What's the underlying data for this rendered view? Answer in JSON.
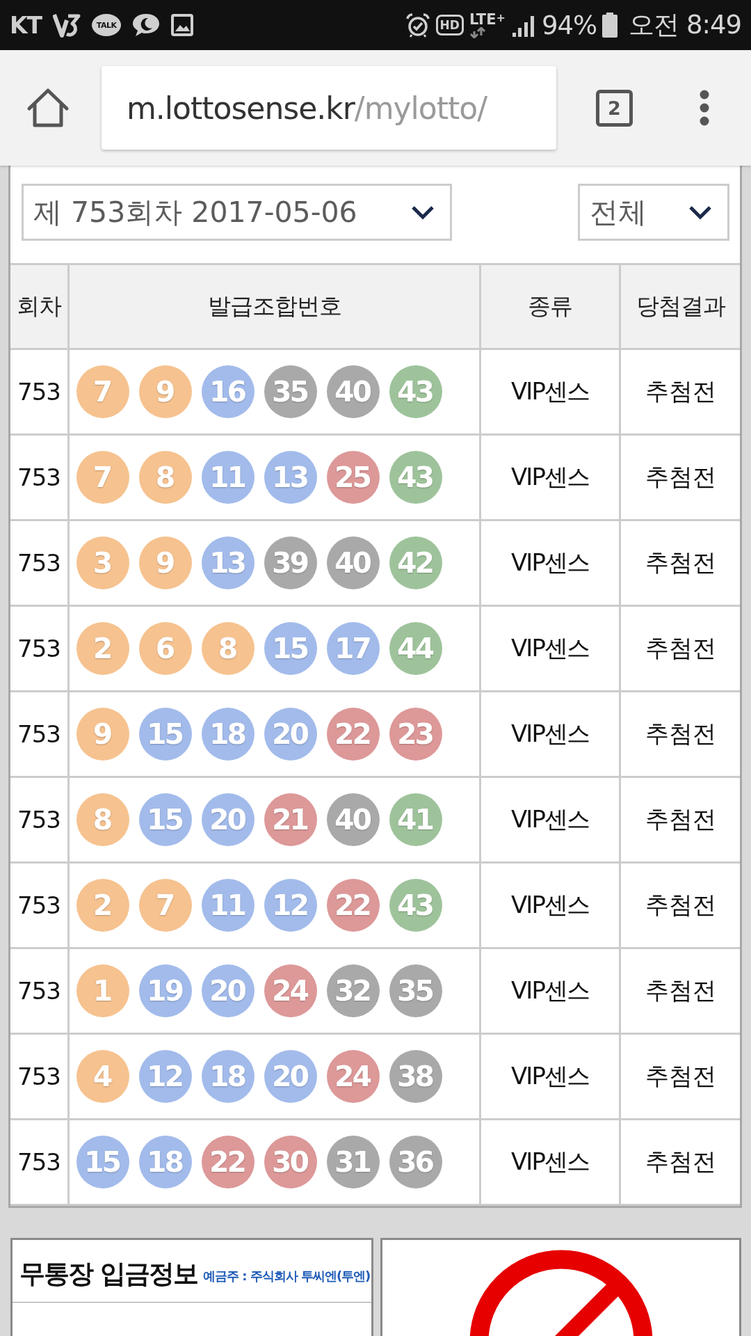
{
  "status_bar": {
    "carrier": "KT",
    "talk_label": "TALK",
    "hd_label": "HD",
    "network": "LTE$^{+}$",
    "battery": "94%",
    "time": "오전 8:49"
  },
  "browser": {
    "url_host": "m.lottosense.kr",
    "url_path": "/mylotto/",
    "tab_count": "2"
  },
  "round_select": {
    "value": "제 753회차 2017-05-06"
  },
  "type_select": {
    "value": "전체"
  },
  "table": {
    "columns": [
      "회차",
      "발급조합번호",
      "종류",
      "당첨결과"
    ],
    "rows": [
      {
        "round": "753",
        "balls": [
          {
            "number": "7",
            "color": "#f6c28f"
          },
          {
            "number": "9",
            "color": "#f6c28f"
          },
          {
            "number": "16",
            "color": "#a2bbeb"
          },
          {
            "number": "35",
            "color": "#a9a9a9"
          },
          {
            "number": "40",
            "color": "#a9a9a9"
          },
          {
            "number": "43",
            "color": "#9ec39b"
          }
        ],
        "type": "VIP센스",
        "result": "추첨전"
      },
      {
        "round": "753",
        "balls": [
          {
            "number": "7",
            "color": "#f6c28f"
          },
          {
            "number": "8",
            "color": "#f6c28f"
          },
          {
            "number": "11",
            "color": "#a2bbeb"
          },
          {
            "number": "13",
            "color": "#a2bbeb"
          },
          {
            "number": "25",
            "color": "#dd9898"
          },
          {
            "number": "43",
            "color": "#9ec39b"
          }
        ],
        "type": "VIP센스",
        "result": "추첨전"
      },
      {
        "round": "753",
        "balls": [
          {
            "number": "3",
            "color": "#f6c28f"
          },
          {
            "number": "9",
            "color": "#f6c28f"
          },
          {
            "number": "13",
            "color": "#a2bbeb"
          },
          {
            "number": "39",
            "color": "#a9a9a9"
          },
          {
            "number": "40",
            "color": "#a9a9a9"
          },
          {
            "number": "42",
            "color": "#9ec39b"
          }
        ],
        "type": "VIP센스",
        "result": "추첨전"
      },
      {
        "round": "753",
        "balls": [
          {
            "number": "2",
            "color": "#f6c28f"
          },
          {
            "number": "6",
            "color": "#f6c28f"
          },
          {
            "number": "8",
            "color": "#f6c28f"
          },
          {
            "number": "15",
            "color": "#a2bbeb"
          },
          {
            "number": "17",
            "color": "#a2bbeb"
          },
          {
            "number": "44",
            "color": "#9ec39b"
          }
        ],
        "type": "VIP센스",
        "result": "추첨전"
      },
      {
        "round": "753",
        "balls": [
          {
            "number": "9",
            "color": "#f6c28f"
          },
          {
            "number": "15",
            "color": "#a2bbeb"
          },
          {
            "number": "18",
            "color": "#a2bbeb"
          },
          {
            "number": "20",
            "color": "#a2bbeb"
          },
          {
            "number": "22",
            "color": "#dd9898"
          },
          {
            "number": "23",
            "color": "#dd9898"
          }
        ],
        "type": "VIP센스",
        "result": "추첨전"
      },
      {
        "round": "753",
        "balls": [
          {
            "number": "8",
            "color": "#f6c28f"
          },
          {
            "number": "15",
            "color": "#a2bbeb"
          },
          {
            "number": "20",
            "color": "#a2bbeb"
          },
          {
            "number": "21",
            "color": "#dd9898"
          },
          {
            "number": "40",
            "color": "#a9a9a9"
          },
          {
            "number": "41",
            "color": "#9ec39b"
          }
        ],
        "type": "VIP센스",
        "result": "추첨전"
      },
      {
        "round": "753",
        "balls": [
          {
            "number": "2",
            "color": "#f6c28f"
          },
          {
            "number": "7",
            "color": "#f6c28f"
          },
          {
            "number": "11",
            "color": "#a2bbeb"
          },
          {
            "number": "12",
            "color": "#a2bbeb"
          },
          {
            "number": "22",
            "color": "#dd9898"
          },
          {
            "number": "43",
            "color": "#9ec39b"
          }
        ],
        "type": "VIP센스",
        "result": "추첨전"
      },
      {
        "round": "753",
        "balls": [
          {
            "number": "1",
            "color": "#f6c28f"
          },
          {
            "number": "19",
            "color": "#a2bbeb"
          },
          {
            "number": "20",
            "color": "#a2bbeb"
          },
          {
            "number": "24",
            "color": "#dd9898"
          },
          {
            "number": "32",
            "color": "#a9a9a9"
          },
          {
            "number": "35",
            "color": "#a9a9a9"
          }
        ],
        "type": "VIP센스",
        "result": "추첨전"
      },
      {
        "round": "753",
        "balls": [
          {
            "number": "4",
            "color": "#f6c28f"
          },
          {
            "number": "12",
            "color": "#a2bbeb"
          },
          {
            "number": "18",
            "color": "#a2bbeb"
          },
          {
            "number": "20",
            "color": "#a2bbeb"
          },
          {
            "number": "24",
            "color": "#dd9898"
          },
          {
            "number": "38",
            "color": "#a9a9a9"
          }
        ],
        "type": "VIP센스",
        "result": "추첨전"
      },
      {
        "round": "753",
        "balls": [
          {
            "number": "15",
            "color": "#a2bbeb"
          },
          {
            "number": "18",
            "color": "#a2bbeb"
          },
          {
            "number": "22",
            "color": "#dd9898"
          },
          {
            "number": "30",
            "color": "#dd9898"
          },
          {
            "number": "31",
            "color": "#a9a9a9"
          },
          {
            "number": "36",
            "color": "#a9a9a9"
          }
        ],
        "type": "VIP센스",
        "result": "추첨전"
      }
    ]
  },
  "deposit_info": {
    "title": "무통장 입금정보",
    "account_holder": "예금주 : 주식회사 투씨엔(투엔)"
  }
}
